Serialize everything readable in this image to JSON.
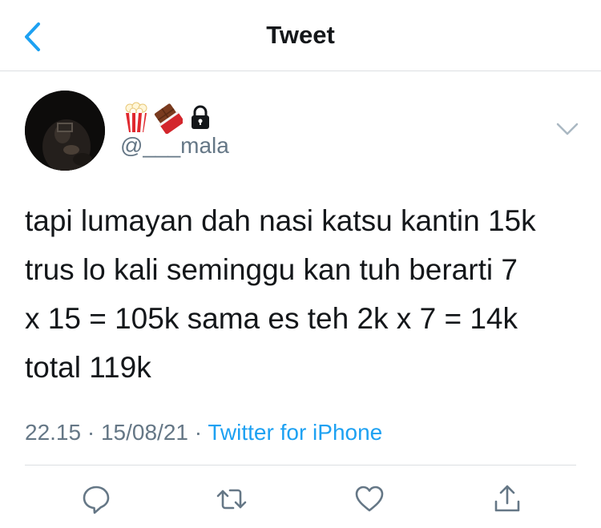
{
  "header": {
    "title": "Tweet"
  },
  "author": {
    "emojis": [
      "popcorn",
      "chocolate-bar",
      "lock"
    ],
    "handle": "@___mala"
  },
  "tweet": {
    "lines": [
      "tapi lumayan dah nasi katsu kantin 15k",
      "trus lo kali seminggu kan tuh berarti 7",
      "x 15 = 105k sama es teh 2k x 7 = 14k",
      "total 119k"
    ]
  },
  "meta": {
    "time": "22.15",
    "separator": "·",
    "date": "15/08/21",
    "source": "Twitter for iPhone"
  },
  "colors": {
    "accent": "#1da1f2",
    "text": "#14171a",
    "muted": "#657786",
    "divider": "#dcdfe2"
  },
  "icons": {
    "back": "chevron-left-icon",
    "more": "chevron-down-icon",
    "reply": "reply-icon",
    "retweet": "retweet-icon",
    "like": "heart-icon",
    "share": "share-icon"
  }
}
